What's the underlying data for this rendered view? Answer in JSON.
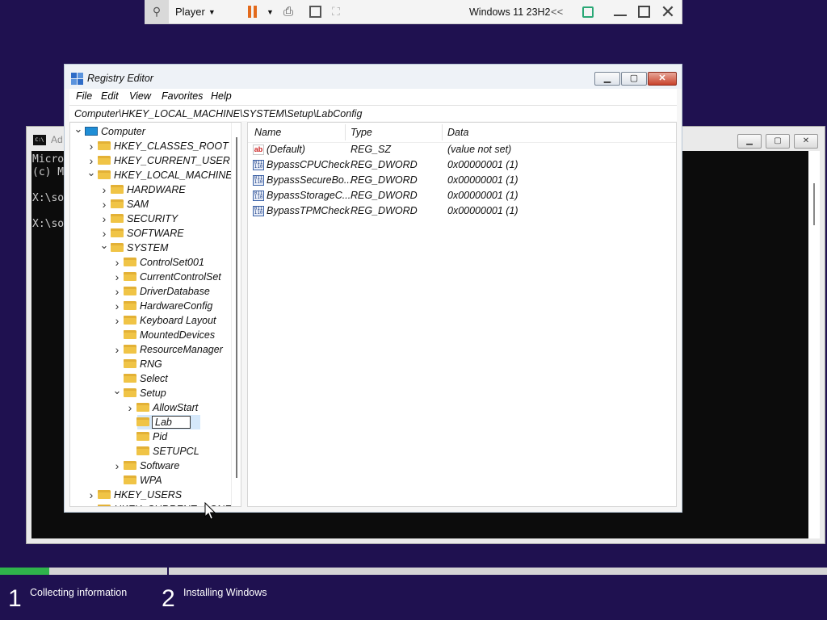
{
  "vm_toolbar": {
    "player_label": "Player",
    "os_name": "Windows 11 23H2",
    "collapse_glyph": "<<",
    "icons": [
      "pin-icon",
      "pause-icon",
      "send-ctrl-alt-del-icon",
      "fit-guest-icon",
      "unity-icon",
      "notes-icon",
      "minimize-icon",
      "maximize-icon",
      "close-icon"
    ]
  },
  "console": {
    "title": "Ad",
    "lines": [
      "Micro",
      "(c) M",
      "",
      "X:\\so",
      "",
      "X:\\so"
    ]
  },
  "regedit": {
    "title": "Registry Editor",
    "menu": [
      "File",
      "Edit",
      "View",
      "Favorites",
      "Help"
    ],
    "address": "Computer\\HKEY_LOCAL_MACHINE\\SYSTEM\\Setup\\LabConfig",
    "tree": [
      {
        "label": "Computer",
        "level": 0,
        "expander": "open",
        "icon": "computer"
      },
      {
        "label": "HKEY_CLASSES_ROOT",
        "level": 1,
        "expander": "closed"
      },
      {
        "label": "HKEY_CURRENT_USER",
        "level": 1,
        "expander": "closed"
      },
      {
        "label": "HKEY_LOCAL_MACHINE",
        "level": 1,
        "expander": "open"
      },
      {
        "label": "HARDWARE",
        "level": 2,
        "expander": "closed"
      },
      {
        "label": "SAM",
        "level": 2,
        "expander": "closed"
      },
      {
        "label": "SECURITY",
        "level": 2,
        "expander": "closed"
      },
      {
        "label": "SOFTWARE",
        "level": 2,
        "expander": "closed"
      },
      {
        "label": "SYSTEM",
        "level": 2,
        "expander": "open"
      },
      {
        "label": "ControlSet001",
        "level": 3,
        "expander": "closed"
      },
      {
        "label": "CurrentControlSet",
        "level": 3,
        "expander": "closed"
      },
      {
        "label": "DriverDatabase",
        "level": 3,
        "expander": "closed"
      },
      {
        "label": "HardwareConfig",
        "level": 3,
        "expander": "closed"
      },
      {
        "label": "Keyboard Layout",
        "level": 3,
        "expander": "closed"
      },
      {
        "label": "MountedDevices",
        "level": 3,
        "expander": "none"
      },
      {
        "label": "ResourceManager",
        "level": 3,
        "expander": "closed"
      },
      {
        "label": "RNG",
        "level": 3,
        "expander": "none"
      },
      {
        "label": "Select",
        "level": 3,
        "expander": "none"
      },
      {
        "label": "Setup",
        "level": 3,
        "expander": "open"
      },
      {
        "label": "AllowStart",
        "level": 4,
        "expander": "closed"
      },
      {
        "label": "Lab",
        "level": 4,
        "expander": "none",
        "editing": true
      },
      {
        "label": "Pid",
        "level": 4,
        "expander": "none"
      },
      {
        "label": "SETUPCL",
        "level": 4,
        "expander": "none"
      },
      {
        "label": "Software",
        "level": 3,
        "expander": "closed"
      },
      {
        "label": "WPA",
        "level": 3,
        "expander": "none"
      },
      {
        "label": "HKEY_USERS",
        "level": 1,
        "expander": "closed"
      },
      {
        "label": "HKEY_CURRENT_CONFIG",
        "level": 1,
        "expander": "closed"
      }
    ],
    "columns": {
      "name": "Name",
      "type": "Type",
      "data": "Data"
    },
    "values": [
      {
        "name": "(Default)",
        "type": "REG_SZ",
        "data": "(value not set)",
        "icon": "string-value-icon"
      },
      {
        "name": "BypassCPUCheck",
        "type": "REG_DWORD",
        "data": "0x00000001 (1)",
        "icon": "binary-value-icon"
      },
      {
        "name": "BypassSecureBo...",
        "type": "REG_DWORD",
        "data": "0x00000001 (1)",
        "icon": "binary-value-icon"
      },
      {
        "name": "BypassStorageC...",
        "type": "REG_DWORD",
        "data": "0x00000001 (1)",
        "icon": "binary-value-icon"
      },
      {
        "name": "BypassTPMCheck",
        "type": "REG_DWORD",
        "data": "0x00000001 (1)",
        "icon": "binary-value-icon"
      }
    ]
  },
  "setup_progress": {
    "fill_fraction": 0.06,
    "steps": [
      {
        "number": "1",
        "label": "Collecting information"
      },
      {
        "number": "2",
        "label": "Installing Windows"
      }
    ]
  },
  "colors": {
    "desktop": "#1f1150",
    "progress": "#2fb34b",
    "pause_accent": "#e36a1c",
    "close_button": "#c8432c",
    "tree_selection": "#d5e8fa"
  }
}
